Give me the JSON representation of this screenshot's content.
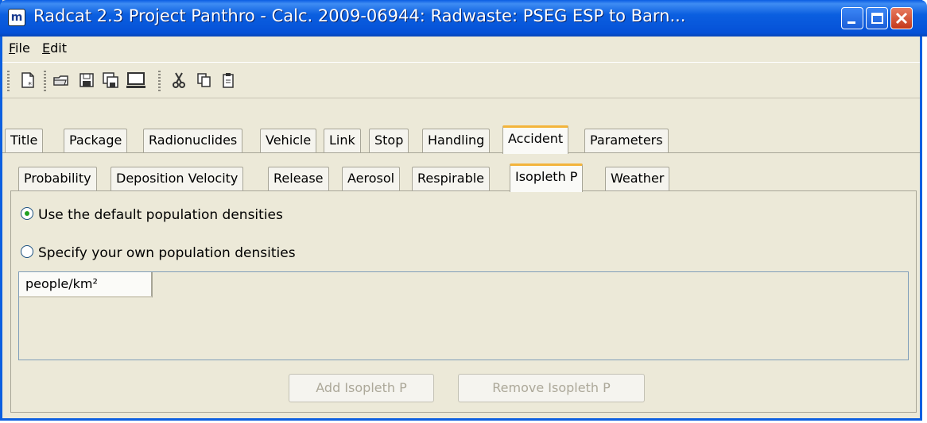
{
  "window": {
    "title": "Radcat 2.3 Project Panthro - Calc. 2009-06944: Radwaste: PSEG ESP to Barn...",
    "app_icon": "sandia-logo-icon",
    "controls": {
      "minimize": "minimize-icon",
      "maximize": "maximize-icon",
      "close": "close-icon"
    }
  },
  "menu": {
    "file": {
      "mnemonic": "F",
      "rest": "ile"
    },
    "edit": {
      "mnemonic": "E",
      "rest": "dit"
    }
  },
  "toolbar": {
    "icons": [
      "new-document-icon",
      "open-folder-icon",
      "save-icon",
      "save-all-icon",
      "monitor-icon",
      "cut-icon",
      "copy-icon",
      "paste-icon"
    ]
  },
  "main_tabs": [
    "Title",
    "Package",
    "Radionuclides",
    "Vehicle",
    "Link",
    "Stop",
    "Handling",
    "Accident",
    "Parameters"
  ],
  "main_tab_active": "Accident",
  "sub_tabs": [
    "Probability",
    "Deposition Velocity",
    "Release",
    "Aerosol",
    "Respirable",
    "Isopleth P",
    "Weather"
  ],
  "sub_tab_active": "Isopleth P",
  "options": {
    "default_label": "Use the default population densities",
    "default_selected": true,
    "custom_label": "Specify your own population densities",
    "custom_selected": false
  },
  "table": {
    "column_header": "people/km²"
  },
  "buttons": {
    "add": "Add Isopleth P",
    "remove": "Remove Isopleth P",
    "enabled": false
  },
  "colors": {
    "titlebar": "#0b5fe0",
    "active_tab_accent": "#f3b43b",
    "radio_dot": "#21a121"
  }
}
